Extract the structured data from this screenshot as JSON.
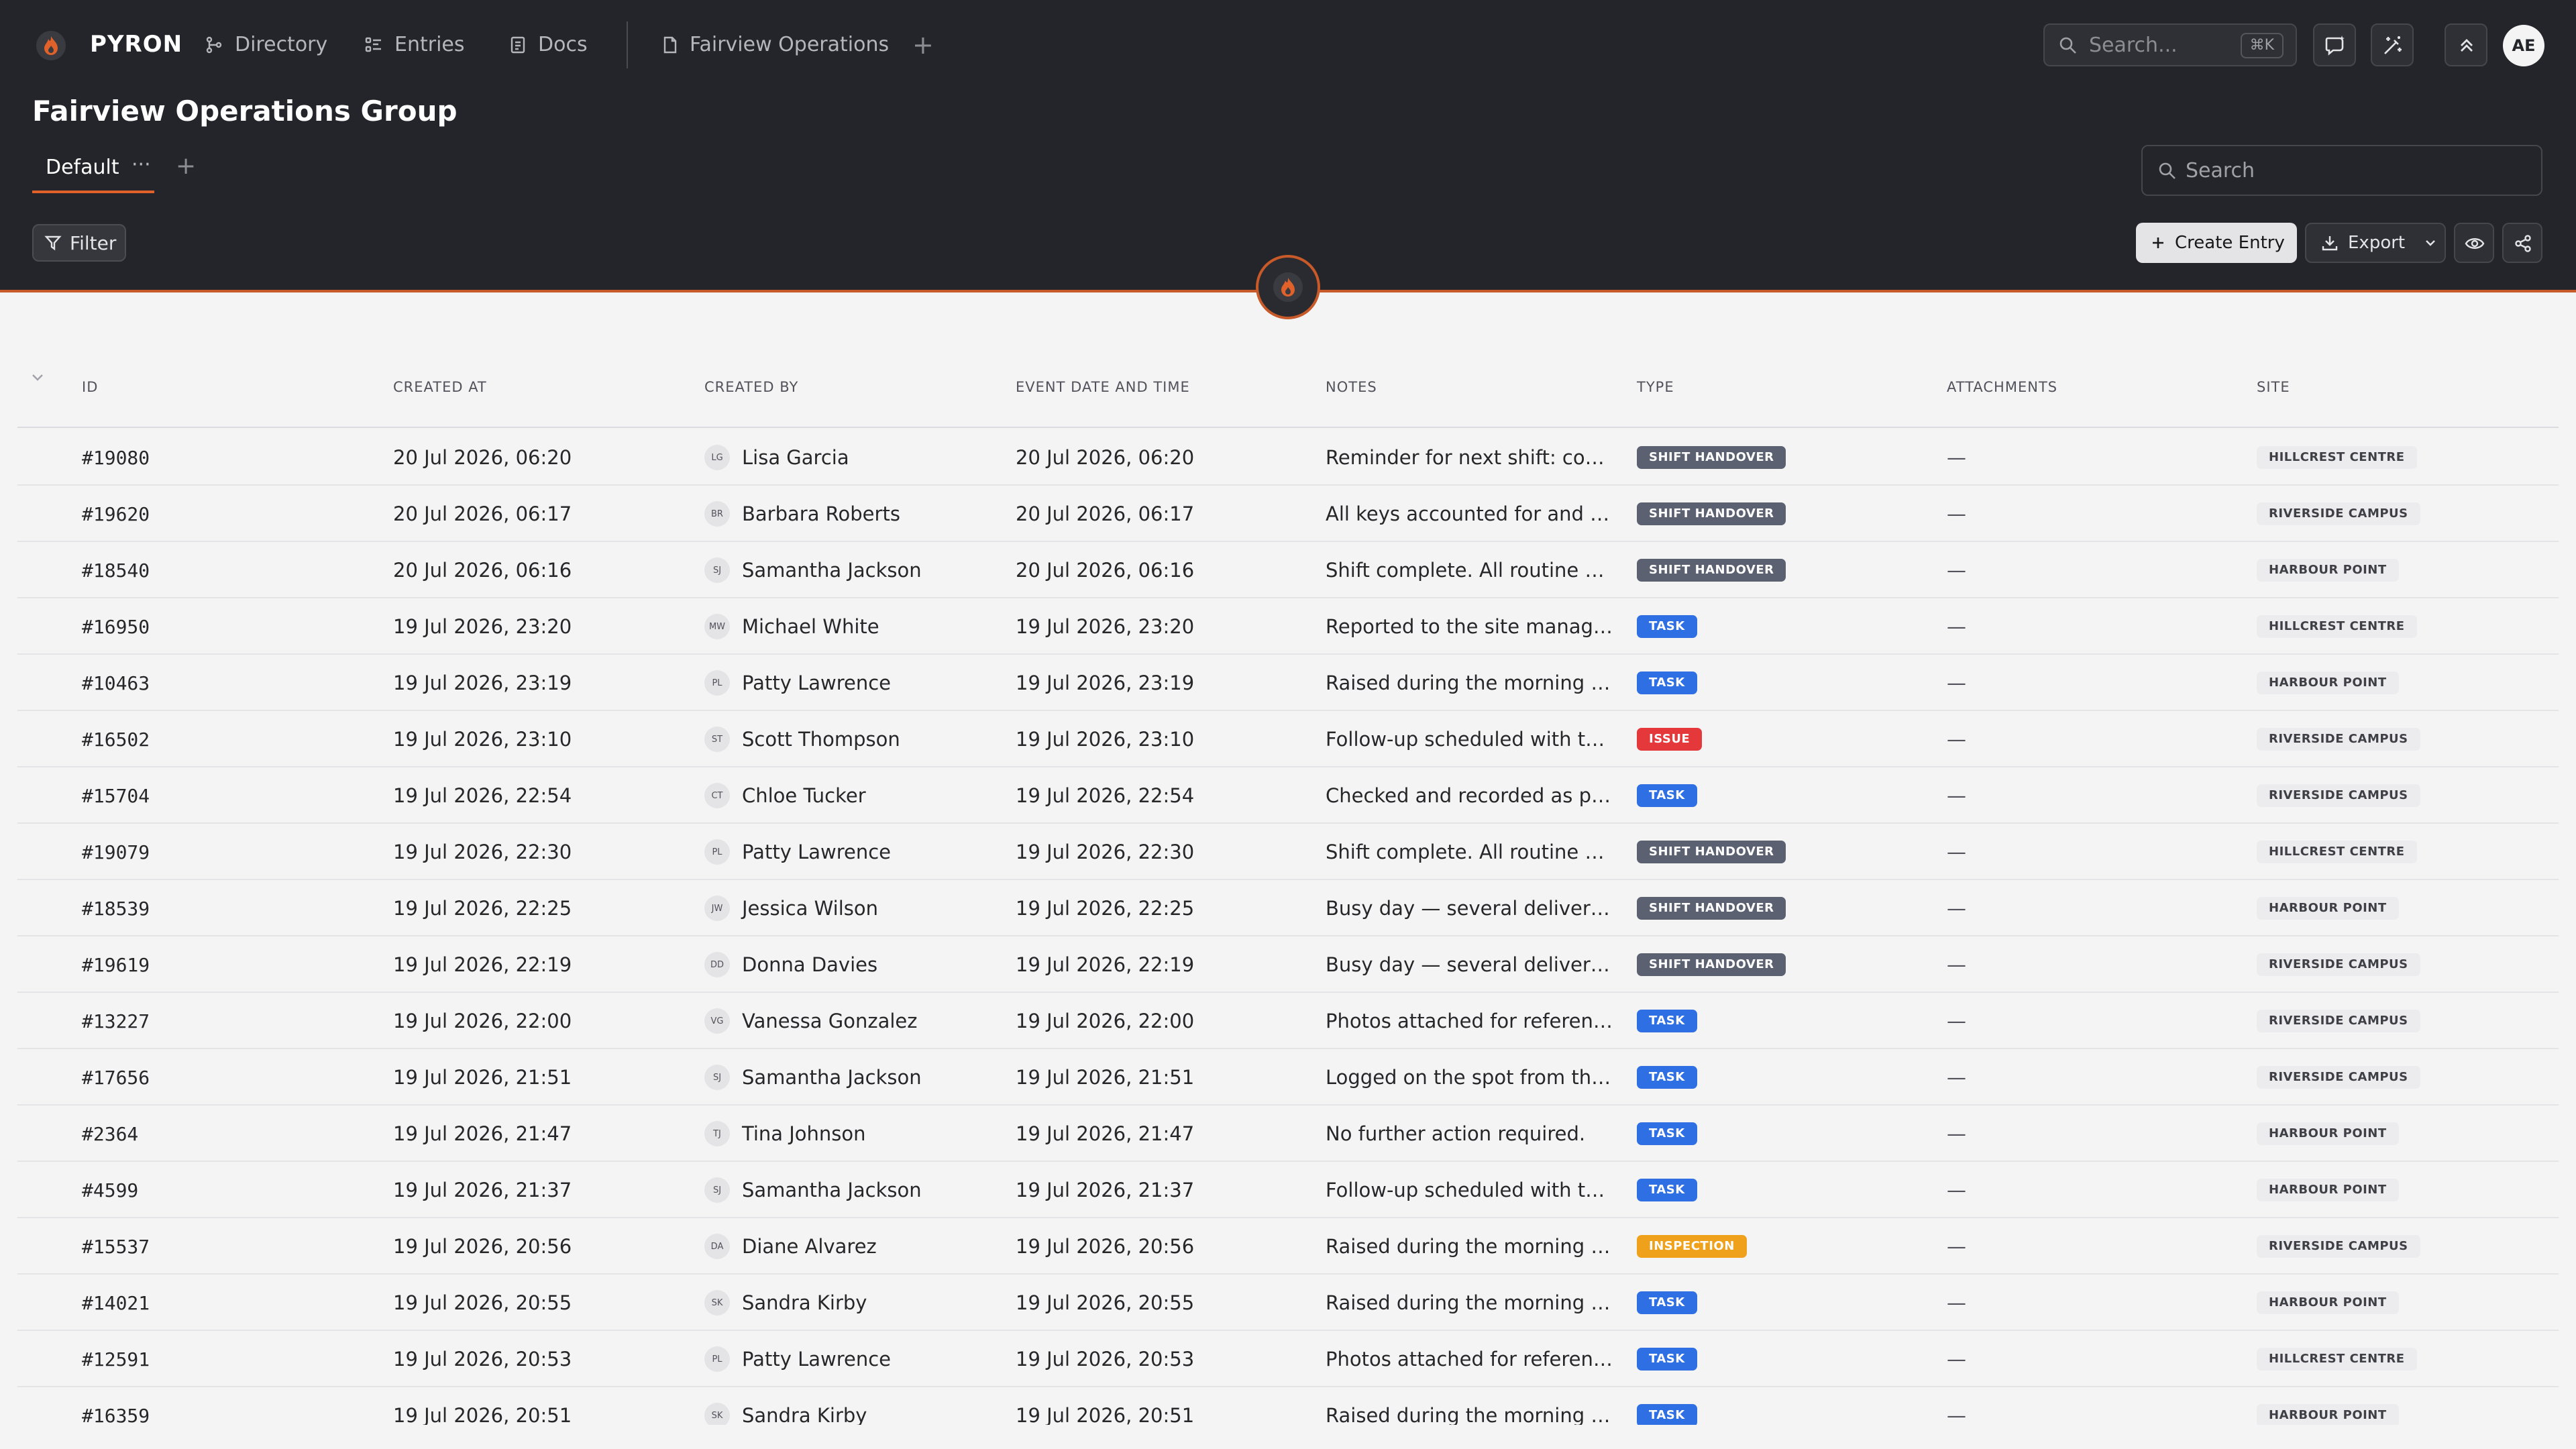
{
  "app": {
    "brand": "PYRON",
    "avatar_initials": "AE"
  },
  "nav": {
    "items": [
      {
        "label": "Directory",
        "icon": "directory-icon"
      },
      {
        "label": "Entries",
        "icon": "entries-icon"
      },
      {
        "label": "Docs",
        "icon": "docs-icon"
      }
    ],
    "open_doc": {
      "label": "Fairview Operations",
      "icon": "document-icon"
    },
    "search_placeholder": "Search...",
    "search_shortcut": "⌘K"
  },
  "page": {
    "title": "Fairview Operations Group",
    "tabs": [
      {
        "label": "Default",
        "more": "···"
      }
    ],
    "search_placeholder": "Search"
  },
  "toolbar": {
    "filter_label": "Filter",
    "create_label": "Create Entry",
    "export_label": "Export"
  },
  "table": {
    "headers": {
      "id": "ID",
      "created_at": "CREATED AT",
      "created_by": "CREATED BY",
      "event": "EVENT DATE AND TIME",
      "notes": "NOTES",
      "type": "TYPE",
      "attachments": "ATTACHMENTS",
      "site": "SITE"
    },
    "type_colors": {
      "SHIFT HANDOVER": "#5b6170",
      "TASK": "#2f6fe4",
      "ISSUE": "#e5383b",
      "INSPECTION": "#f0a11b"
    },
    "rows": [
      {
        "id": "#19080",
        "created_at": "20 Jul 2026, 06:20",
        "initials": "LG",
        "created_by": "Lisa Garcia",
        "event": "20 Jul 2026, 06:20",
        "notes": "Reminder for next shift: cool room temperature",
        "type": "SHIFT HANDOVER",
        "attachments": "—",
        "site": "HILLCREST CENTRE"
      },
      {
        "id": "#19620",
        "created_at": "20 Jul 2026, 06:17",
        "initials": "BR",
        "created_by": "Barbara Roberts",
        "event": "20 Jul 2026, 06:17",
        "notes": "All keys accounted for and the site secured",
        "type": "SHIFT HANDOVER",
        "attachments": "—",
        "site": "RIVERSIDE CAMPUS"
      },
      {
        "id": "#18540",
        "created_at": "20 Jul 2026, 06:16",
        "initials": "SJ",
        "created_by": "Samantha Jackson",
        "event": "20 Jul 2026, 06:16",
        "notes": "Shift complete. All routine checks completed",
        "type": "SHIFT HANDOVER",
        "attachments": "—",
        "site": "HARBOUR POINT"
      },
      {
        "id": "#16950",
        "created_at": "19 Jul 2026, 23:20",
        "initials": "MW",
        "created_by": "Michael White",
        "event": "19 Jul 2026, 23:20",
        "notes": "Reported to the site manager and logged",
        "type": "TASK",
        "attachments": "—",
        "site": "HILLCREST CENTRE"
      },
      {
        "id": "#10463",
        "created_at": "19 Jul 2026, 23:19",
        "initials": "PL",
        "created_by": "Patty Lawrence",
        "event": "19 Jul 2026, 23:19",
        "notes": "Raised during the morning walkthrough",
        "type": "TASK",
        "attachments": "—",
        "site": "HARBOUR POINT"
      },
      {
        "id": "#16502",
        "created_at": "19 Jul 2026, 23:10",
        "initials": "ST",
        "created_by": "Scott Thompson",
        "event": "19 Jul 2026, 23:10",
        "notes": "Follow-up scheduled with the facilities team",
        "type": "ISSUE",
        "attachments": "—",
        "site": "RIVERSIDE CAMPUS"
      },
      {
        "id": "#15704",
        "created_at": "19 Jul 2026, 22:54",
        "initials": "CT",
        "created_by": "Chloe Tucker",
        "event": "19 Jul 2026, 22:54",
        "notes": "Checked and recorded as per site procedure",
        "type": "TASK",
        "attachments": "—",
        "site": "RIVERSIDE CAMPUS"
      },
      {
        "id": "#19079",
        "created_at": "19 Jul 2026, 22:30",
        "initials": "PL",
        "created_by": "Patty Lawrence",
        "event": "19 Jul 2026, 22:30",
        "notes": "Shift complete. All routine checks completed",
        "type": "SHIFT HANDOVER",
        "attachments": "—",
        "site": "HILLCREST CENTRE"
      },
      {
        "id": "#18539",
        "created_at": "19 Jul 2026, 22:25",
        "initials": "JW",
        "created_by": "Jessica Wilson",
        "event": "19 Jul 2026, 22:25",
        "notes": "Busy day — several deliveries and visitors",
        "type": "SHIFT HANDOVER",
        "attachments": "—",
        "site": "HARBOUR POINT"
      },
      {
        "id": "#19619",
        "created_at": "19 Jul 2026, 22:19",
        "initials": "DD",
        "created_by": "Donna Davies",
        "event": "19 Jul 2026, 22:19",
        "notes": "Busy day — several deliveries and visitors",
        "type": "SHIFT HANDOVER",
        "attachments": "—",
        "site": "RIVERSIDE CAMPUS"
      },
      {
        "id": "#13227",
        "created_at": "19 Jul 2026, 22:00",
        "initials": "VG",
        "created_by": "Vanessa Gonzalez",
        "event": "19 Jul 2026, 22:00",
        "notes": "Photos attached for reference.",
        "type": "TASK",
        "attachments": "—",
        "site": "RIVERSIDE CAMPUS"
      },
      {
        "id": "#17656",
        "created_at": "19 Jul 2026, 21:51",
        "initials": "SJ",
        "created_by": "Samantha Jackson",
        "event": "19 Jul 2026, 21:51",
        "notes": "Logged on the spot from the mobile app",
        "type": "TASK",
        "attachments": "—",
        "site": "RIVERSIDE CAMPUS"
      },
      {
        "id": "#2364",
        "created_at": "19 Jul 2026, 21:47",
        "initials": "TJ",
        "created_by": "Tina Johnson",
        "event": "19 Jul 2026, 21:47",
        "notes": "No further action required.",
        "type": "TASK",
        "attachments": "—",
        "site": "HARBOUR POINT"
      },
      {
        "id": "#4599",
        "created_at": "19 Jul 2026, 21:37",
        "initials": "SJ",
        "created_by": "Samantha Jackson",
        "event": "19 Jul 2026, 21:37",
        "notes": "Follow-up scheduled with the facilities team",
        "type": "TASK",
        "attachments": "—",
        "site": "HARBOUR POINT"
      },
      {
        "id": "#15537",
        "created_at": "19 Jul 2026, 20:56",
        "initials": "DA",
        "created_by": "Diane Alvarez",
        "event": "19 Jul 2026, 20:56",
        "notes": "Raised during the morning walkthrough",
        "type": "INSPECTION",
        "attachments": "—",
        "site": "RIVERSIDE CAMPUS"
      },
      {
        "id": "#14021",
        "created_at": "19 Jul 2026, 20:55",
        "initials": "SK",
        "created_by": "Sandra Kirby",
        "event": "19 Jul 2026, 20:55",
        "notes": "Raised during the morning walkthrough",
        "type": "TASK",
        "attachments": "—",
        "site": "HARBOUR POINT"
      },
      {
        "id": "#12591",
        "created_at": "19 Jul 2026, 20:53",
        "initials": "PL",
        "created_by": "Patty Lawrence",
        "event": "19 Jul 2026, 20:53",
        "notes": "Photos attached for reference.",
        "type": "TASK",
        "attachments": "—",
        "site": "HILLCREST CENTRE"
      },
      {
        "id": "#16359",
        "created_at": "19 Jul 2026, 20:51",
        "initials": "SK",
        "created_by": "Sandra Kirby",
        "event": "19 Jul 2026, 20:51",
        "notes": "Raised during the morning walkthrough",
        "type": "TASK",
        "attachments": "—",
        "site": "HARBOUR POINT"
      }
    ]
  }
}
